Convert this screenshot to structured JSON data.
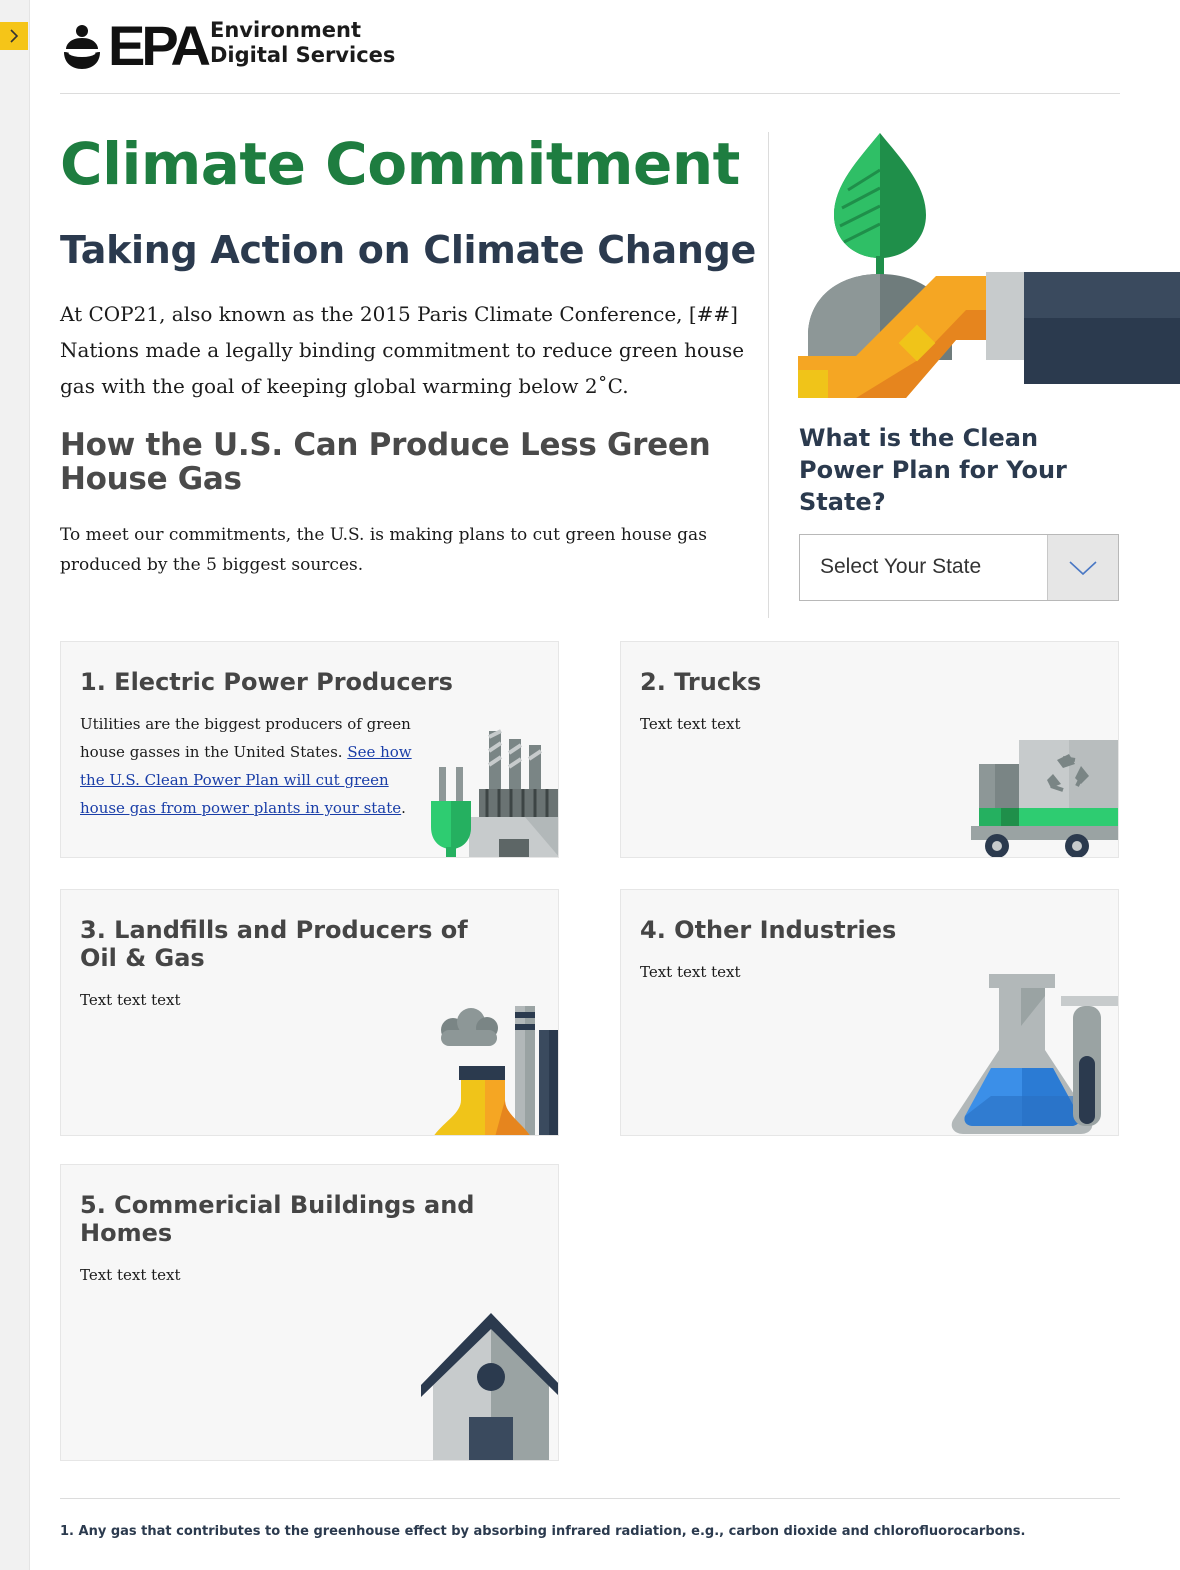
{
  "header": {
    "logo_text": "EPA",
    "site_name_line1": "Environment",
    "site_name_line2": "Digital Services"
  },
  "main": {
    "title": "Climate Commitment",
    "subtitle": "Taking Action on Climate Change",
    "intro": "At COP21, also known as the 2015 Paris Climate Conference, [##] Nations made a legally binding commitment to reduce green house gas with the goal of keeping global warming below 2˚C.",
    "section_heading": "How the U.S. Can Produce Less Green House Gas",
    "lead": "To meet our commitments, the U.S. is making plans to cut green house gas produced by the 5  biggest sources."
  },
  "sidebar": {
    "question": "What is the Clean Power Plan for Your State?",
    "select_label": "Select Your State"
  },
  "cards": [
    {
      "title": "1. Electric Power Producers",
      "body_prefix": "Utilities are the biggest producers of green house gasses in the United States. ",
      "link_text": "See how the U.S. Clean Power Plan will cut green house gas from power plants in your state",
      "body_suffix": "."
    },
    {
      "title": "2. Trucks",
      "body": "Text text text"
    },
    {
      "title": "3. Landfills and Producers of Oil & Gas",
      "body": "Text text text"
    },
    {
      "title": "4. Other Industries",
      "body": "Text text text"
    },
    {
      "title": "5. Commericial Buildings and Homes",
      "body": "Text text text"
    }
  ],
  "footnote": "1. Any gas that contributes to the greenhouse effect by absorbing infrared radiation, e.g., carbon dioxide and chlorofluorocarbons.",
  "icons": [
    "chevron-right-icon",
    "epa-flower-icon",
    "chevron-down-icon",
    "leaf-hand-illustration",
    "power-plant-illustration",
    "recycling-truck-illustration",
    "refinery-illustration",
    "lab-flask-illustration",
    "house-illustration"
  ],
  "colors": {
    "title_green": "#1e7d40",
    "heading_navy": "#2b3a4e",
    "toggle_yellow": "#f5c518",
    "link_blue": "#1a3ea8"
  }
}
